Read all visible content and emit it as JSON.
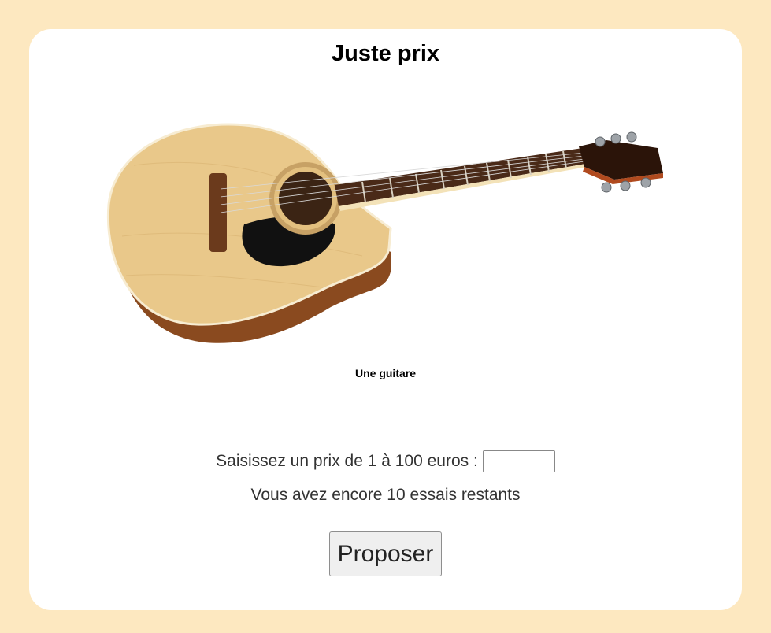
{
  "page": {
    "title": "Juste prix",
    "background_color": "#fde8c0",
    "card_color": "#ffffff"
  },
  "product": {
    "image_icon": "acoustic-guitar-image",
    "caption": "Une guitare"
  },
  "form": {
    "prompt": "Saisissez un prix de 1 à 100 euros :",
    "input_value": "",
    "attempts_text": "Vous avez encore 10 essais restants",
    "submit_label": "Proposer"
  }
}
